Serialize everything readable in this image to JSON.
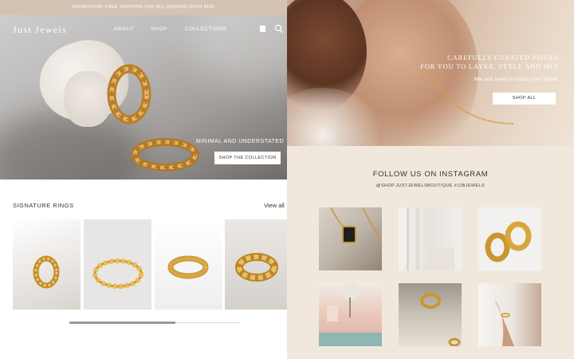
{
  "promo": {
    "text": "PROMOTION: FREE SHIPPING FOR ALL ORDERS OVER $100"
  },
  "header": {
    "brand": "Just Jewels",
    "nav": [
      "ABOUT",
      "SHOP",
      "COLLECTIONS"
    ],
    "icons": [
      "shopping-bag-icon",
      "search-icon"
    ]
  },
  "hero": {
    "caption": "MINIMAL AND UNDERSTATED",
    "button": "SHOP THE COLLECTION"
  },
  "signature_rings": {
    "title": "SIGNATURE RINGS",
    "view_all": "View all",
    "items": [
      "ring-braided",
      "ring-beaded",
      "ring-ribbed",
      "ring-dome"
    ],
    "scroll_fraction": 0.62
  },
  "banner": {
    "title_line1": "CAREFULLY CURATED PIECES",
    "title_line2": "FOR YOU TO LAYER, STYLE AND MIX",
    "subtitle": "Mix and layer to match your mood",
    "button": "SHOP ALL"
  },
  "instagram": {
    "title": "FOLLOW US ON INSTAGRAM",
    "handle": "@SHOP.JUSTJEWELSBOUTIQUE #JJBJEWELS",
    "posts": [
      "necklace-post",
      "curtain-post",
      "hoops-post",
      "courtyard-post",
      "ring-post",
      "bracelet-post"
    ]
  },
  "colors": {
    "promo_bar": "#d4c2b3",
    "instagram_background": "#f1e8dd",
    "gold": "#c9962f"
  }
}
